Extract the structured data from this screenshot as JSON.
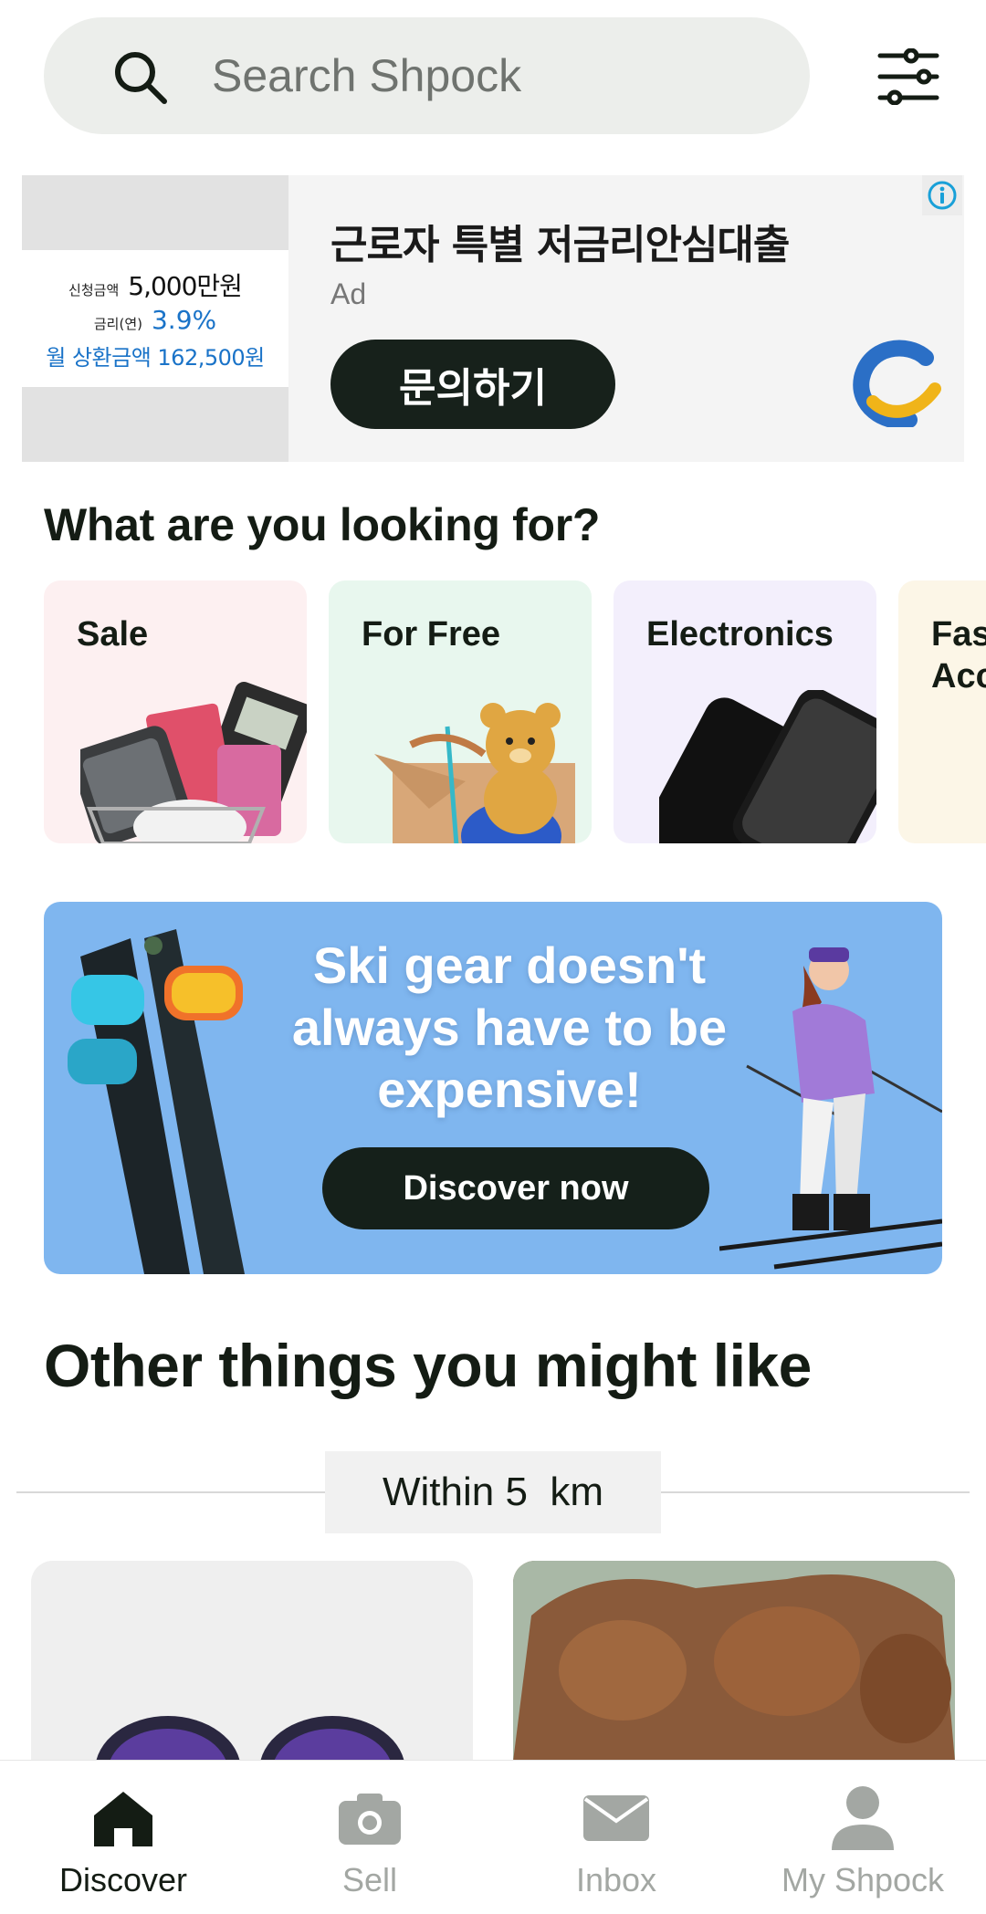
{
  "search": {
    "placeholder": "Search Shpock"
  },
  "ad": {
    "image_lines": {
      "row1_small": "신청금액",
      "row1_big": "5,000만원",
      "row2_small": "금리(연)",
      "row2_big": "3.9%",
      "row3": "월 상환금액 162,500원"
    },
    "title": "근로자 특별 저금리안심대출",
    "label": "Ad",
    "cta": "문의하기",
    "info_icon": "info-icon"
  },
  "discover": {
    "title": "What are you looking for?",
    "categories": [
      {
        "label": "Sale"
      },
      {
        "label": "For Free"
      },
      {
        "label": "Electronics"
      },
      {
        "label": "Fas\nAcc"
      }
    ]
  },
  "promo": {
    "text": "Ski gear doesn't always have to be expensive!",
    "cta": "Discover now"
  },
  "other": {
    "title": "Other things you might like",
    "distance": "Within 5  km"
  },
  "nav": {
    "items": [
      {
        "label": "Discover",
        "icon": "home-icon",
        "active": true
      },
      {
        "label": "Sell",
        "icon": "camera-icon",
        "active": false
      },
      {
        "label": "Inbox",
        "icon": "mail-icon",
        "active": false
      },
      {
        "label": "My Shpock",
        "icon": "person-icon",
        "active": false
      }
    ]
  },
  "colors": {
    "dark": "#141c14",
    "promo_bg": "#7fb6ef",
    "sale_bg": "#fdf0f1",
    "free_bg": "#e8f7ee",
    "elec_bg": "#f3effc",
    "fashion_bg": "#fcf6e7"
  }
}
